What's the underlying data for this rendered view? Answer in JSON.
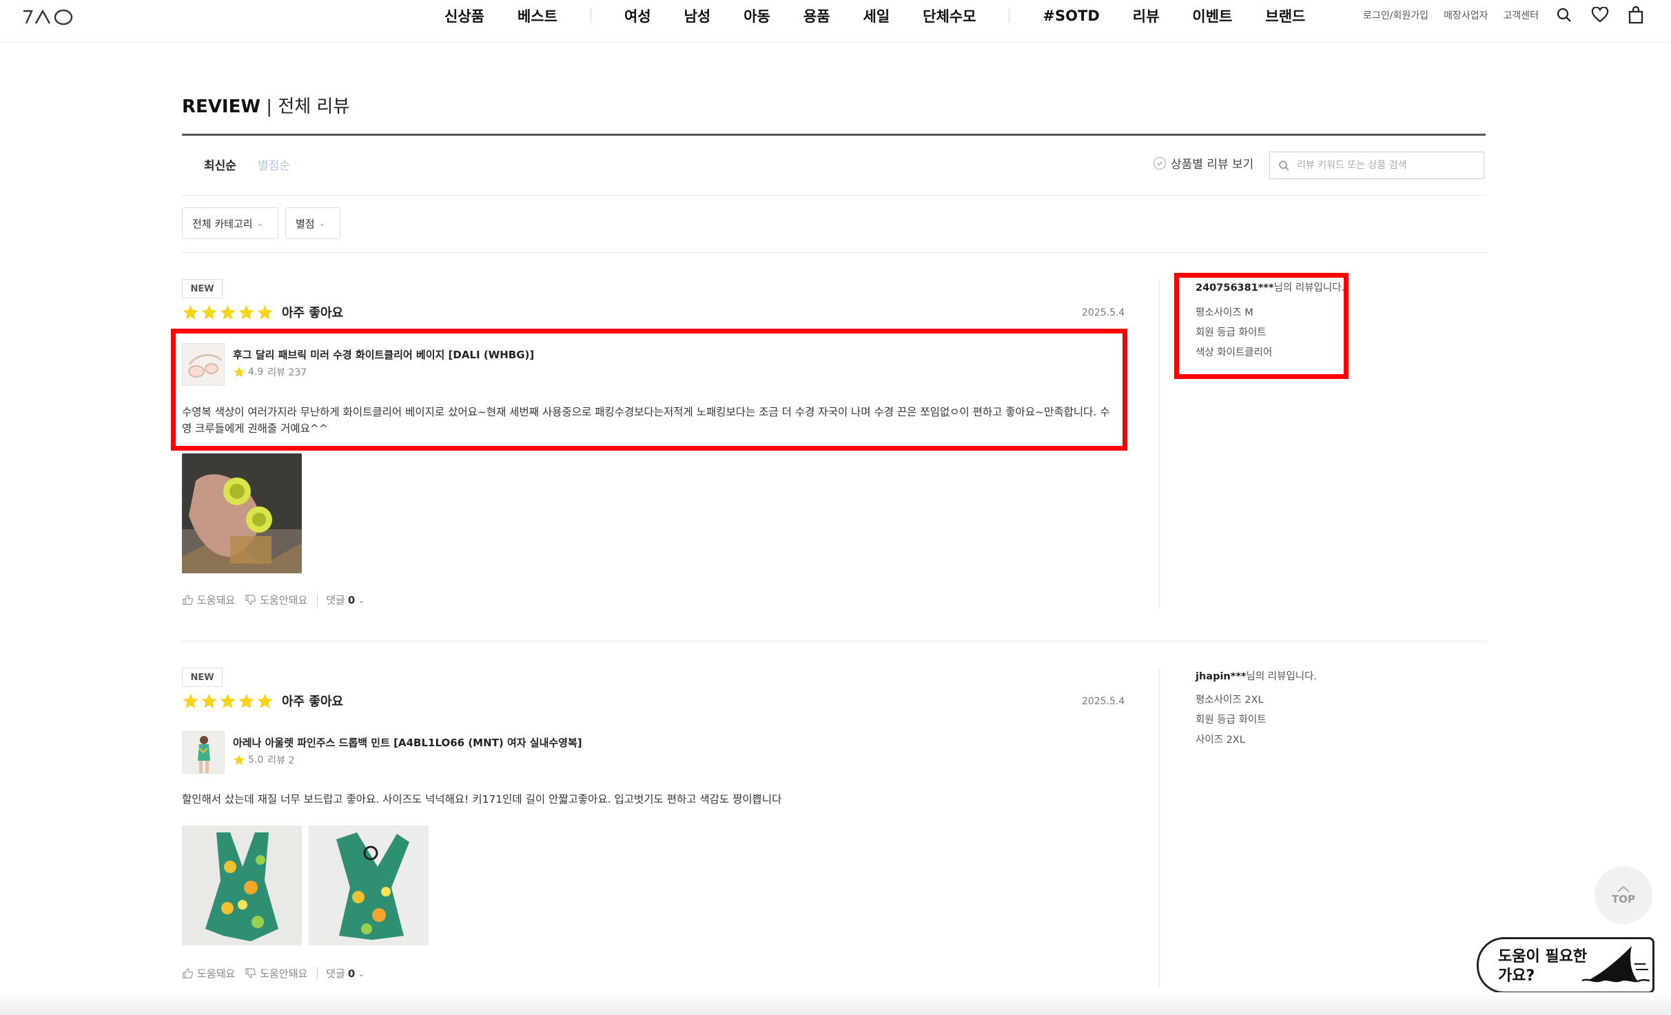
{
  "header": {
    "nav": [
      "신상품",
      "베스트",
      "여성",
      "남성",
      "아동",
      "용품",
      "세일",
      "단체수모",
      "#SOTD",
      "리뷰",
      "이벤트",
      "브랜드"
    ],
    "util_links": [
      "로그인/회원가입",
      "매장사업자",
      "고객센터"
    ],
    "icons": [
      "search-icon",
      "heart-icon",
      "shopping-bag-icon"
    ]
  },
  "page": {
    "title_main": "REVIEW",
    "title_sub": " | 전체 리뷰"
  },
  "sort": {
    "latest": "최신순",
    "rating": "별점순",
    "by_product": "상품별 리뷰 보기",
    "search_placeholder": "리뷰 키워드 또는 상품 검색"
  },
  "filters": {
    "category": "전체 카테고리",
    "rating": "별점"
  },
  "reviews": [
    {
      "badge": "NEW",
      "rating": 5,
      "rating_label": "아주 좋아요",
      "date": "2025.5.4",
      "product_name": "후그 달리 패브릭 미러 수경 화이트클리어 베이지 [DALI (WHBG)]",
      "product_score": "4.9",
      "product_reviews": "리뷰 237",
      "text": "수영복 색상이 여러가지라 무난하게 화이트클리어 베이지로 샀어요~현재 세번째 사용중으로 패킹수경보다는저적게 노패킹보다는 조금 더 수경 자국이 나며 수경 끈은 쪼임없ㅇ이 편하고 좋아요~만족합니다. 수영 크루들에게 권해줄 거예요^^",
      "helpful": "도움돼요",
      "not_helpful": "도움안돼요",
      "comments_label": "댓글",
      "comments_count": "0",
      "reviewer_id": "240756381***",
      "reviewer_suffix": "님의 리뷰입니다.",
      "attributes": [
        "평소사이즈 M",
        "회원 등급 화이트",
        "색상 화이트클리어"
      ]
    },
    {
      "badge": "NEW",
      "rating": 5,
      "rating_label": "아주 좋아요",
      "date": "2025.5.4",
      "product_name": "아레나 아울렛 파인주스 드롭백 민트 [A4BL1LO66 (MNT) 여자 실내수영복]",
      "product_score": "5.0",
      "product_reviews": "리뷰 2",
      "text": "할인해서 샀는데 재질 너무 보드랍고 좋아요. 사이즈도 넉넉해요! 키171인데 길이 안짧고좋아요. 입고벗기도 편하고 색감도 짱이쁩니다",
      "helpful": "도움돼요",
      "not_helpful": "도움안돼요",
      "comments_label": "댓글",
      "comments_count": "0",
      "reviewer_id": "jhapin***",
      "reviewer_suffix": "님의 리뷰입니다.",
      "attributes": [
        "평소사이즈 2XL",
        "회원 등급 화이트",
        "사이즈 2XL"
      ]
    }
  ],
  "floating": {
    "top": "TOP",
    "help": "도움이 필요한가요?"
  },
  "colors": {
    "highlight": "#ff0000",
    "star": "#f7d417",
    "accent_muted": "#b8c4e0"
  }
}
